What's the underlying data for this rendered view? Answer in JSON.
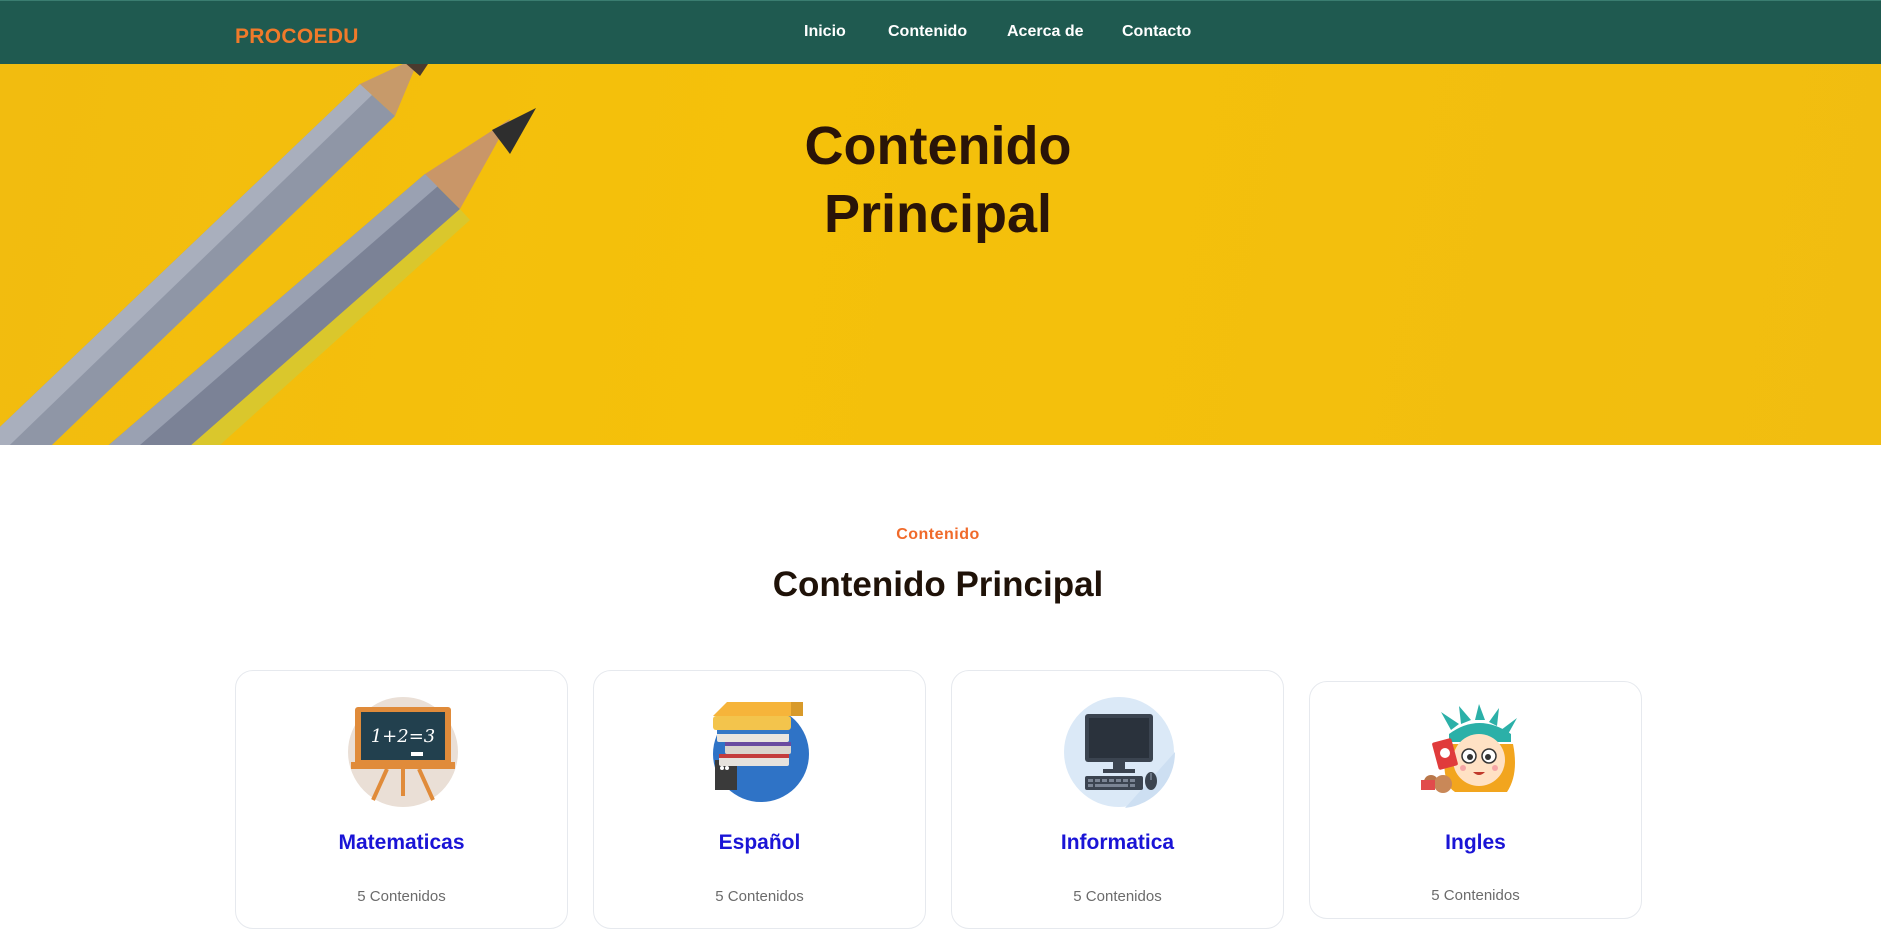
{
  "navbar": {
    "brand": "PROCOEDU",
    "links": [
      "Inicio",
      "Contenido",
      "Acerca de",
      "Contacto"
    ]
  },
  "hero": {
    "title_line1": "Contenido",
    "title_line2": "Principal"
  },
  "section": {
    "kicker": "Contenido",
    "title": "Contenido Principal"
  },
  "cards": [
    {
      "title": "Matematicas",
      "count": "5 Contenidos",
      "icon": "chalkboard-icon",
      "blackboard_text": "1+2=3"
    },
    {
      "title": "Español",
      "count": "5 Contenidos",
      "icon": "books-icon"
    },
    {
      "title": "Informatica",
      "count": "5 Contenidos",
      "icon": "computer-icon"
    },
    {
      "title": "Ingles",
      "count": "5 Contenidos",
      "icon": "liberty-girl-icon"
    }
  ],
  "colors": {
    "navbar_bg": "#1f5a50",
    "brand": "#f07a2a",
    "hero_bg": "#f5c10a",
    "kicker": "#f06a2a",
    "card_title": "#1a14d6"
  }
}
